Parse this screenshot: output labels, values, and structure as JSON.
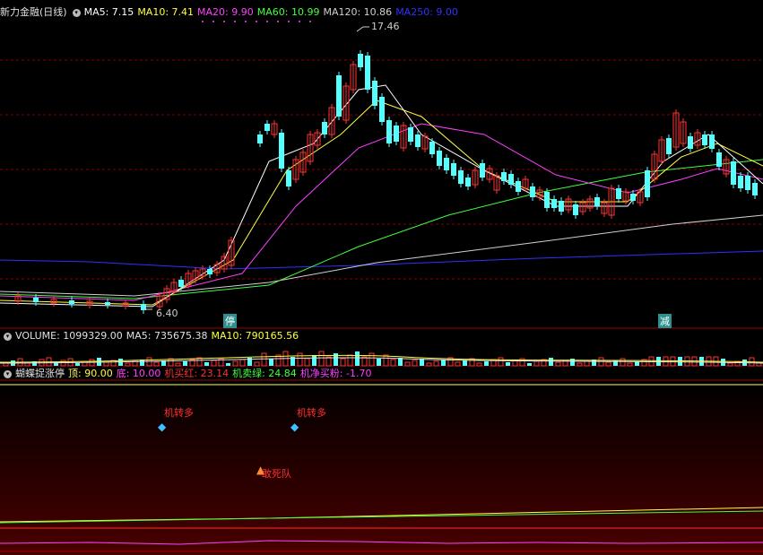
{
  "main_panel": {
    "stock_name": "新力金融(日线)",
    "ma": [
      {
        "label": "MA5: 7.15",
        "color": "#ffffff"
      },
      {
        "label": "MA10: 7.41",
        "color": "#ffff40"
      },
      {
        "label": "MA20: 9.90",
        "color": "#ff40ff"
      },
      {
        "label": "MA60: 10.99",
        "color": "#40ff40"
      },
      {
        "label": "MA120: 10.86",
        "color": "#d0d0d0"
      },
      {
        "label": "MA250: 9.00",
        "color": "#2020ff"
      }
    ],
    "high_label": "17.46",
    "low_label": "6.40",
    "tag_stop": "停",
    "tag_reduce": "减"
  },
  "volume_panel": {
    "title": "VOLUME: 1099329.00",
    "ma5": "MA5: 735675.38",
    "ma10": "MA10: 790165.56"
  },
  "indicator_panel": {
    "title": "蝴蝶捉涨停",
    "top": "顶: 90.00",
    "bottom": "底: 10.00",
    "buy_red": "机买红: 23.14",
    "sell_green": "机卖绿: 24.84",
    "net_pink": "机净买粉: -1.70",
    "signal_1": "机转多",
    "signal_2": "机转多",
    "signal_3": "敢死队"
  },
  "colors": {
    "up": "#ff3232",
    "down": "#54ffff",
    "grid": "#8b0000"
  }
}
